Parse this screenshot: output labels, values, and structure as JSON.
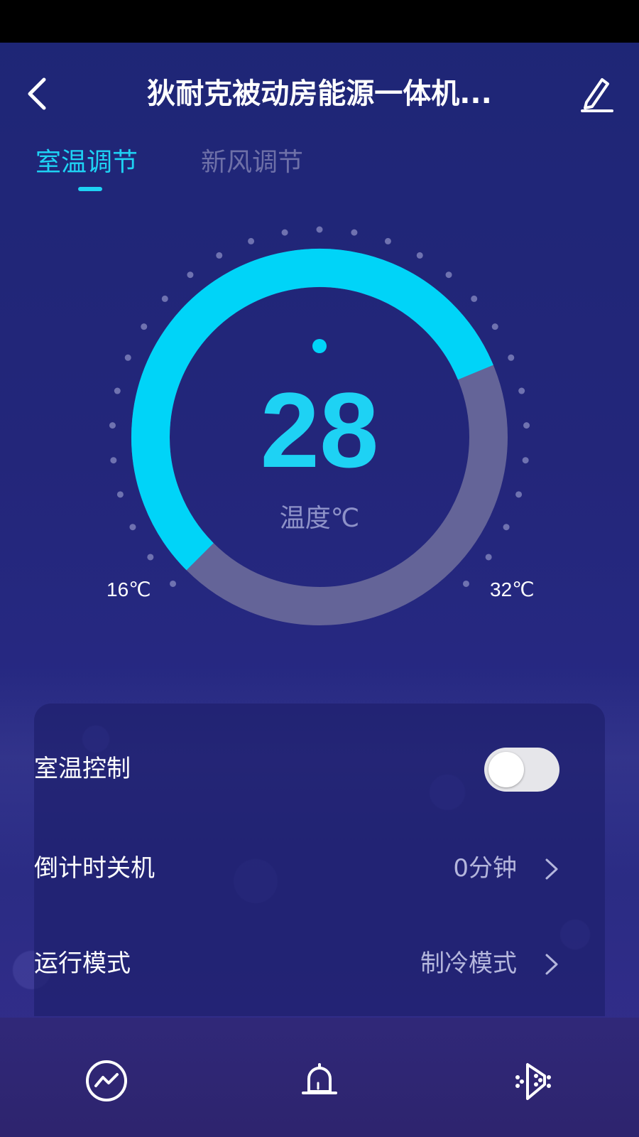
{
  "header": {
    "title": "狄耐克被动房能源一体机...",
    "back_icon": "chevron-left-icon",
    "edit_icon": "pencil-icon"
  },
  "tabs": [
    {
      "label": "室温调节",
      "active": true
    },
    {
      "label": "新风调节",
      "active": false
    }
  ],
  "thermostat": {
    "value": "28",
    "unit_label": "温度℃",
    "min_label": "16℃",
    "max_label": "32℃",
    "min": 16,
    "max": 32,
    "current": 28,
    "colors": {
      "active": "#00d4f8",
      "track": "#6464a0",
      "ticks": "#6f72b0"
    }
  },
  "settings": {
    "room_temp_control": {
      "label": "室温控制",
      "enabled": false
    },
    "countdown_shutdown": {
      "label": "倒计时关机",
      "value": "0分钟"
    },
    "run_mode": {
      "label": "运行模式",
      "value": "制冷模式"
    }
  },
  "bottom_nav": [
    {
      "icon": "trend-chart-icon"
    },
    {
      "icon": "bell-icon"
    },
    {
      "icon": "fan-speaker-icon"
    }
  ]
}
